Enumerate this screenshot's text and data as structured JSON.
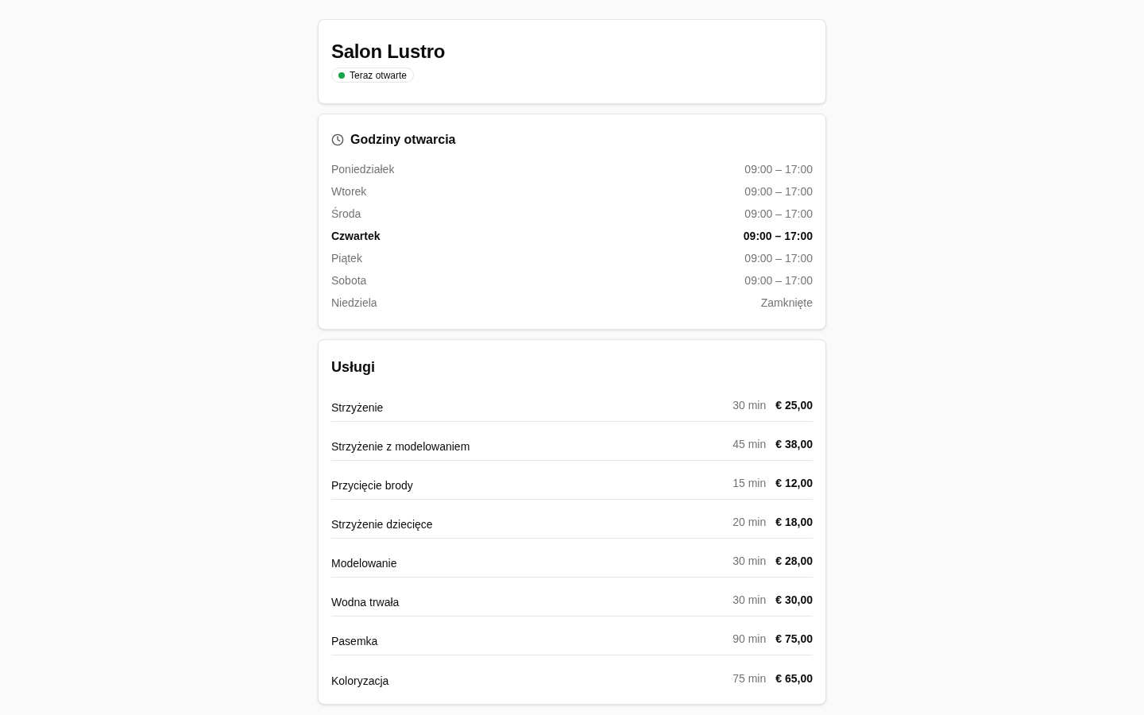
{
  "salon": {
    "name": "Salon Lustro",
    "status": {
      "label": "Teraz otwarte",
      "open": true
    }
  },
  "hours": {
    "title": "Godziny otwarcia",
    "days": [
      {
        "day": "Poniedziałek",
        "time": "09:00 – 17:00",
        "current": false
      },
      {
        "day": "Wtorek",
        "time": "09:00 – 17:00",
        "current": false
      },
      {
        "day": "Środa",
        "time": "09:00 – 17:00",
        "current": false
      },
      {
        "day": "Czwartek",
        "time": "09:00 – 17:00",
        "current": true
      },
      {
        "day": "Piątek",
        "time": "09:00 – 17:00",
        "current": false
      },
      {
        "day": "Sobota",
        "time": "09:00 – 17:00",
        "current": false
      },
      {
        "day": "Niedziela",
        "time": "Zamknięte",
        "current": false
      }
    ]
  },
  "services": {
    "title": "Usługi",
    "items": [
      {
        "name": "Strzyżenie",
        "duration": "30 min",
        "price": "€ 25,00"
      },
      {
        "name": "Strzyżenie z modelowaniem",
        "duration": "45 min",
        "price": "€ 38,00"
      },
      {
        "name": "Przycięcie brody",
        "duration": "15 min",
        "price": "€ 12,00"
      },
      {
        "name": "Strzyżenie dziecięce",
        "duration": "20 min",
        "price": "€ 18,00"
      },
      {
        "name": "Modelowanie",
        "duration": "30 min",
        "price": "€ 28,00"
      },
      {
        "name": "Wodna trwała",
        "duration": "30 min",
        "price": "€ 30,00"
      },
      {
        "name": "Pasemka",
        "duration": "90 min",
        "price": "€ 75,00"
      },
      {
        "name": "Koloryzacja",
        "duration": "75 min",
        "price": "€ 65,00"
      }
    ]
  }
}
